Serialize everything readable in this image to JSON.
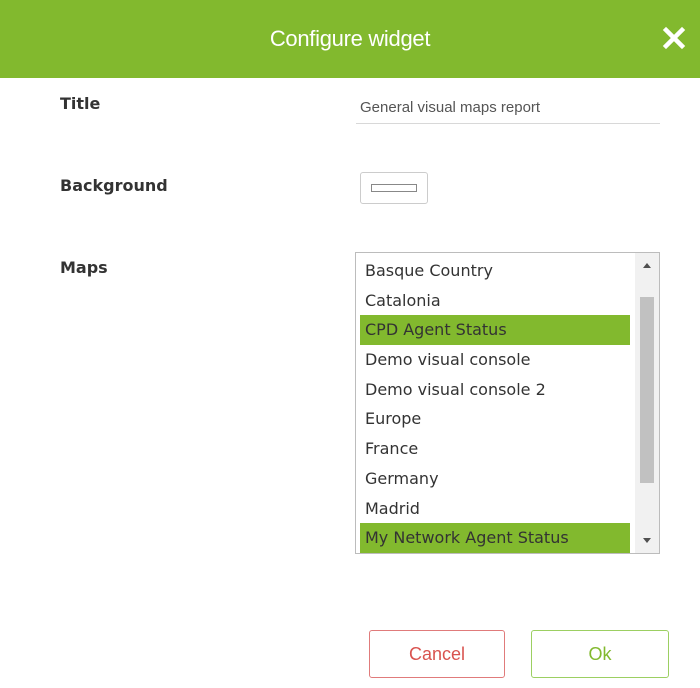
{
  "header": {
    "title": "Configure widget",
    "close_icon": "close-icon"
  },
  "form": {
    "title_label": "Title",
    "title_value": "General visual maps report",
    "background_label": "Background",
    "background_color": "#ffffff",
    "maps_label": "Maps",
    "maps": [
      {
        "label": "Basque Country",
        "selected": false
      },
      {
        "label": "Catalonia",
        "selected": false
      },
      {
        "label": "CPD Agent Status",
        "selected": true
      },
      {
        "label": "Demo visual console",
        "selected": false
      },
      {
        "label": "Demo visual console 2",
        "selected": false
      },
      {
        "label": "Europe",
        "selected": false
      },
      {
        "label": "France",
        "selected": false
      },
      {
        "label": "Germany",
        "selected": false
      },
      {
        "label": "Madrid",
        "selected": false
      },
      {
        "label": "My Network Agent Status",
        "selected": true
      }
    ]
  },
  "buttons": {
    "cancel": "Cancel",
    "ok": "Ok"
  },
  "colors": {
    "accent": "#82b92e",
    "cancel": "#d9534f",
    "selection": "#82b92e"
  }
}
